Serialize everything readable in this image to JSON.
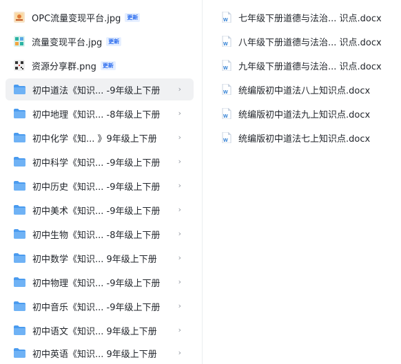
{
  "left_list": {
    "files": [
      {
        "name": "OPC流量变现平台.jpg",
        "badge": "更新",
        "icon": "jpg-thumbnail-icon"
      },
      {
        "name": "流量变现平台.jpg",
        "badge": "更新",
        "icon": "jpg-thumbnail-icon"
      },
      {
        "name": "资源分享群.png",
        "badge": "更新",
        "icon": "png-thumbnail-icon"
      }
    ],
    "folders": [
      {
        "name": "初中道法《知识... -9年级上下册",
        "selected": true
      },
      {
        "name": "初中地理《知识... -8年级上下册"
      },
      {
        "name": "初中化学《知...  》9年级上下册"
      },
      {
        "name": "初中科学《知识... -9年级上下册"
      },
      {
        "name": "初中历史《知识... -9年级上下册"
      },
      {
        "name": "初中美术《知识... -9年级上下册"
      },
      {
        "name": "初中生物《知识... -8年级上下册"
      },
      {
        "name": "初中数学《知识... 9年级上下册"
      },
      {
        "name": "初中物理《知识... -9年级上下册"
      },
      {
        "name": "初中音乐《知识... -9年级上下册"
      },
      {
        "name": "初中语文《知识... 9年级上下册"
      },
      {
        "name": "初中英语《知识... 9年级上下册"
      }
    ],
    "chevron": "›"
  },
  "right_list": {
    "docs": [
      {
        "name": "七年级下册道德与法治... 识点.docx"
      },
      {
        "name": "八年级下册道德与法治... 识点.docx"
      },
      {
        "name": "九年级下册道德与法治... 识点.docx"
      },
      {
        "name": "统编版初中道法八上知识点.docx"
      },
      {
        "name": "统编版初中道法九上知识点.docx"
      },
      {
        "name": "统编版初中道法七上知识点.docx"
      }
    ],
    "icon": "word-doc-icon"
  },
  "colors": {
    "folder": "#6fb2f5",
    "folder_tab": "#4a9bef",
    "badge_bg": "#e6efff",
    "badge_text": "#2b6cee",
    "selected_bg": "#f0f1f3",
    "word_blue": "#2b7cd3"
  }
}
